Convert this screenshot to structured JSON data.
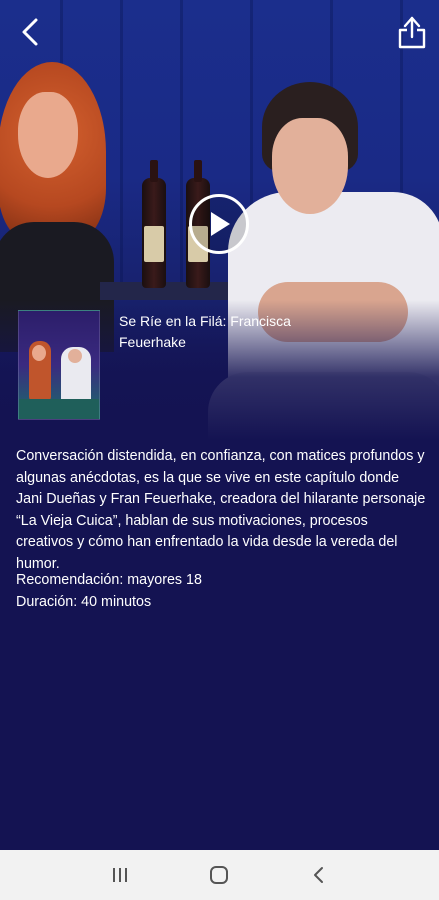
{
  "header": {
    "back_icon": "chevron-left-icon",
    "share_icon": "share-icon"
  },
  "player": {
    "play_icon": "play-icon"
  },
  "episode": {
    "title": "Se Ríe en la Filá: Francisca Feuerhake",
    "description": "Conversación distendida, en confianza, con matices profundos y algunas anécdotas, es la que se vive en este capítulo donde Jani Dueñas y Fran Feuerhake, creadora del hilarante personaje “La Vieja Cuica”, hablan de sus motivaciones, procesos creativos y cómo han enfrentado la vida desde la vereda del humor.",
    "recommendation": "Recomendación: mayores 18",
    "duration": "Duración: 40 minutos"
  },
  "system_nav": {
    "recents_icon": "recents-icon",
    "home_icon": "home-icon",
    "back_icon": "back-icon"
  },
  "colors": {
    "background": "#141352",
    "hero_blue": "#1b2e8c",
    "nav_bar": "#f2f2f2"
  }
}
